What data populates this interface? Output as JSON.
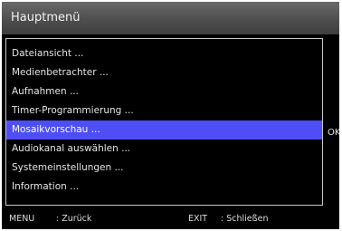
{
  "header": {
    "title": "Hauptmenü"
  },
  "menu": {
    "items": [
      {
        "label": "Dateiansicht ..."
      },
      {
        "label": "Medienbetrachter ..."
      },
      {
        "label": "Aufnahmen ..."
      },
      {
        "label": "Timer-Programmierung ..."
      },
      {
        "label": "Mosaikvorschau ...",
        "selected": true
      },
      {
        "label": "Audiokanal auswählen ..."
      },
      {
        "label": "Systemeinstellungen ..."
      },
      {
        "label": "Information ..."
      }
    ],
    "selected_index": 4,
    "ok_hint": "OK"
  },
  "footer": {
    "menu_key": "MENU",
    "menu_action": ": Zurück",
    "exit_key": "EXIT",
    "exit_action": ": Schließen"
  },
  "colors": {
    "background": "#000000",
    "header": "#4e4e4e",
    "highlight": "#4e4ef6",
    "text": "#e4e4e4"
  }
}
